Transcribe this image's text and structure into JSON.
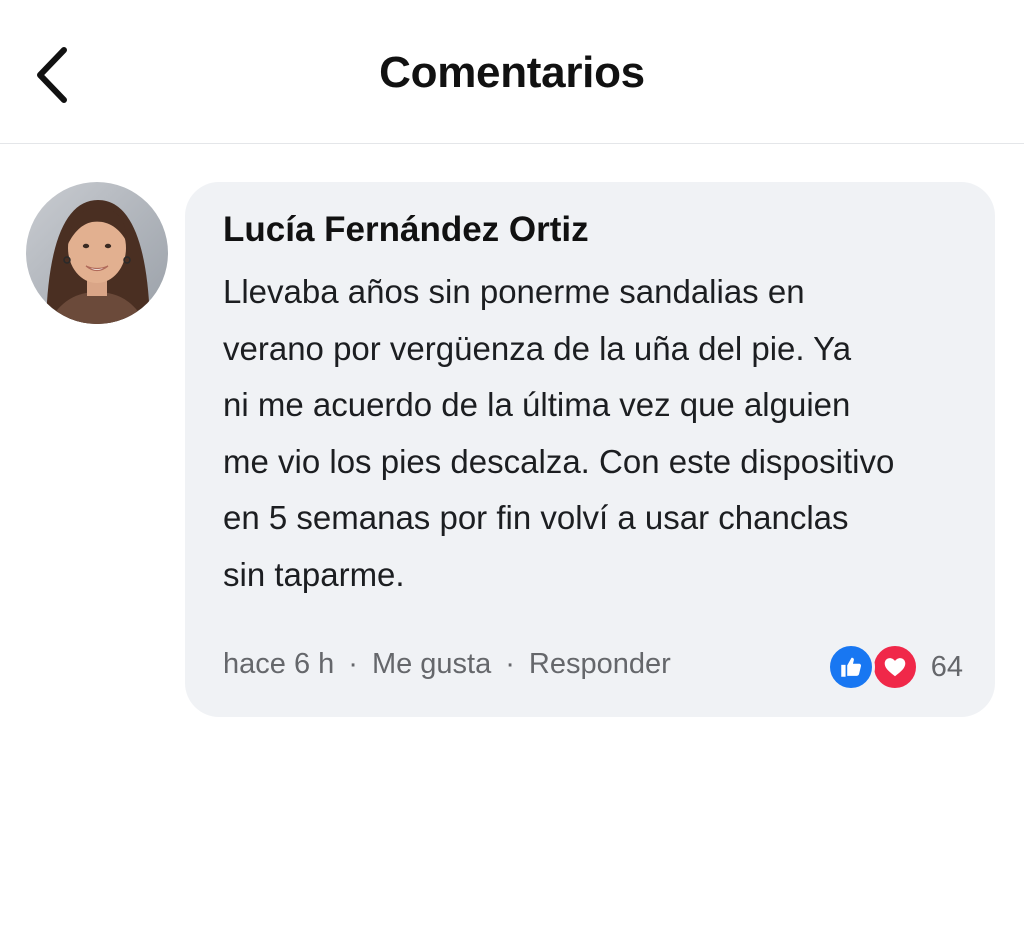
{
  "header": {
    "title": "Comentarios",
    "back_icon": "chevron-left-icon"
  },
  "comment": {
    "author": "Lucía Fernández Ortiz",
    "avatar_icon": "user-avatar",
    "text_lines": [
      "Llevaba años sin ponerme sandalias en",
      "verano por vergüenza de la uña del pie. Ya",
      "ni me acuerdo de la última vez que alguien",
      "me vio los pies descalza. Con este dispositivo",
      "en 5 semanas por fin volví a usar chanclas",
      "sin taparme."
    ],
    "time": "hace 6 h",
    "separator": "·",
    "like_label": "Me gusta",
    "reply_label": "Responder",
    "reactions": {
      "icons": [
        "thumbs-up-icon",
        "heart-icon"
      ],
      "count": "64",
      "like_color": "#1877f2",
      "love_color": "#f02849"
    }
  }
}
